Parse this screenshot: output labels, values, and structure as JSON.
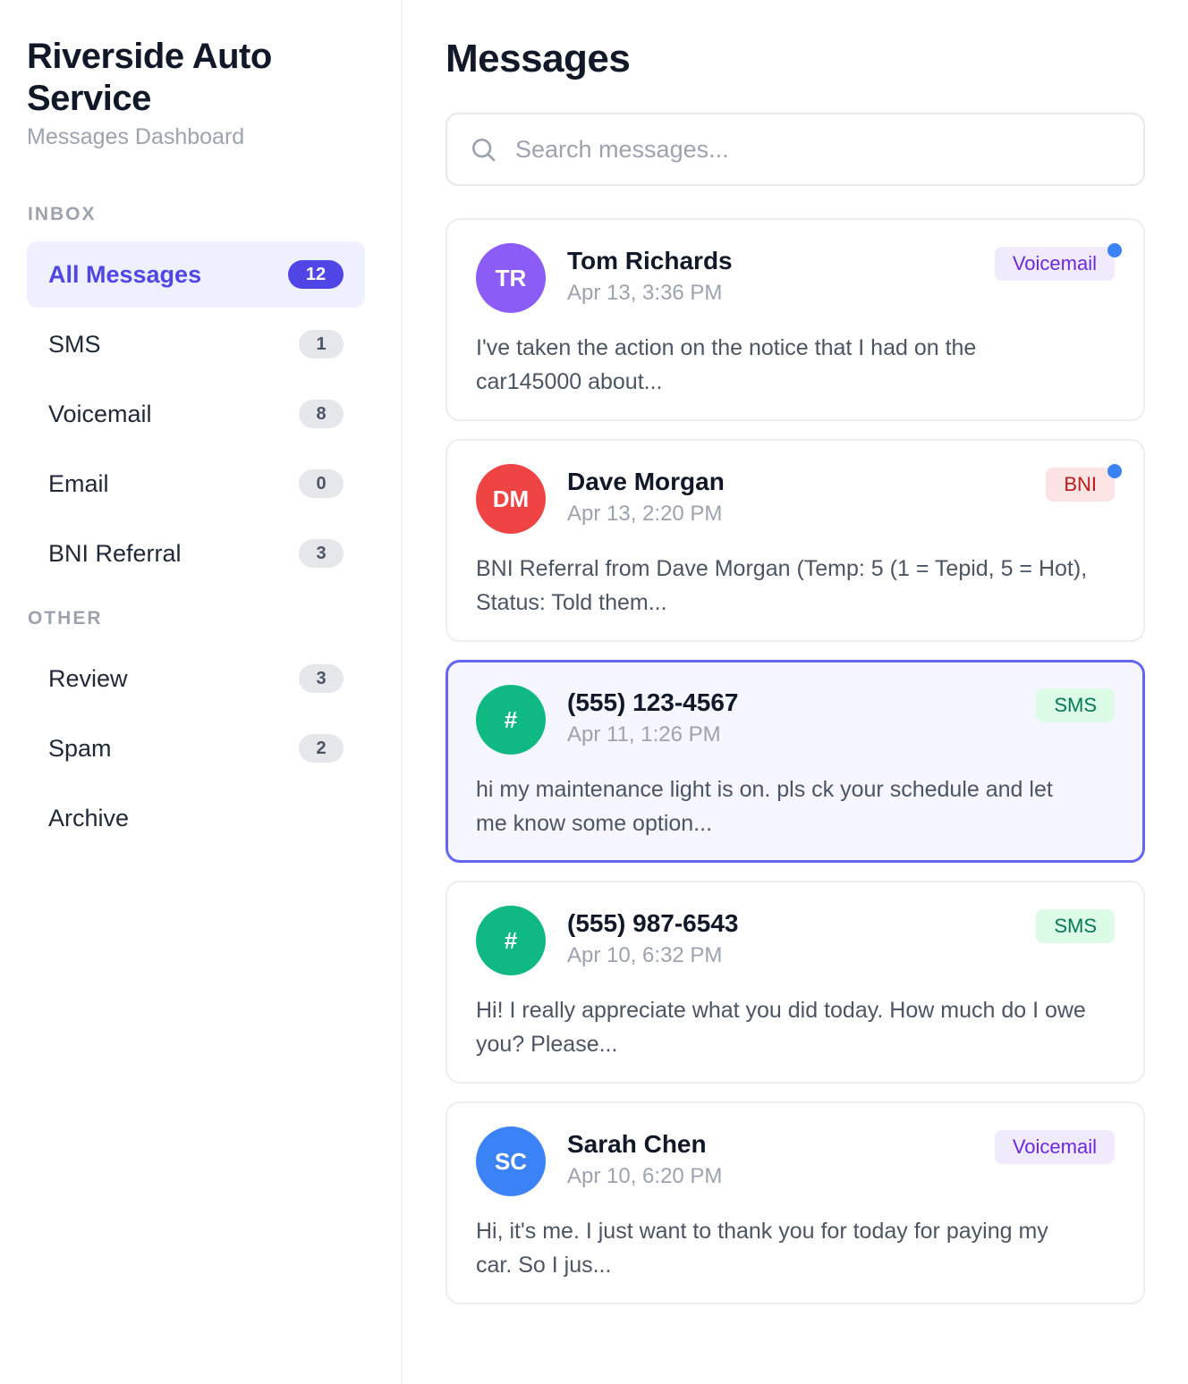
{
  "brand": {
    "title": "Riverside Auto Service",
    "subtitle": "Messages Dashboard"
  },
  "sidebar": {
    "inbox_label": "INBOX",
    "other_label": "OTHER",
    "inbox_items": [
      {
        "label": "All Messages",
        "count": "12",
        "active": true
      },
      {
        "label": "SMS",
        "count": "1"
      },
      {
        "label": "Voicemail",
        "count": "8"
      },
      {
        "label": "Email",
        "count": "0"
      },
      {
        "label": "BNI Referral",
        "count": "3"
      }
    ],
    "other_items": [
      {
        "label": "Review",
        "count": "3"
      },
      {
        "label": "Spam",
        "count": "2"
      },
      {
        "label": "Archive",
        "count": ""
      }
    ]
  },
  "main": {
    "title": "Messages",
    "search_placeholder": "Search messages..."
  },
  "messages": [
    {
      "initials": "TR",
      "avatar_color": "#8b5cf6",
      "sender": "Tom Richards",
      "time": "Apr 13, 3:36 PM",
      "type": "Voicemail",
      "unread": true,
      "preview": "I've taken the action on the notice that I had on the car145000 about..."
    },
    {
      "initials": "DM",
      "avatar_color": "#ef4444",
      "sender": "Dave Morgan",
      "time": "Apr 13, 2:20 PM",
      "type": "BNI",
      "unread": true,
      "preview": "BNI Referral from Dave Morgan (Temp: 5 (1 = Tepid, 5 = Hot), Status: Told them..."
    },
    {
      "initials": "#",
      "avatar_color": "#10b981",
      "sender": "(555) 123-4567",
      "time": "Apr 11, 1:26 PM",
      "type": "SMS",
      "unread": false,
      "selected": true,
      "preview": "hi my maintenance light is on. pls ck your schedule and let me know some option..."
    },
    {
      "initials": "#",
      "avatar_color": "#10b981",
      "sender": "(555) 987-6543",
      "time": "Apr 10, 6:32 PM",
      "type": "SMS",
      "unread": false,
      "preview": "Hi! I really appreciate what you did today. How much do I owe you? Please..."
    },
    {
      "initials": "SC",
      "avatar_color": "#3b82f6",
      "sender": "Sarah Chen",
      "time": "Apr 10, 6:20 PM",
      "type": "Voicemail",
      "unread": false,
      "preview": "Hi, it's me. I just want to thank you for today for paying my car. So I jus..."
    }
  ],
  "colors": {
    "accent": "#4f46e5",
    "selected_border": "#6366f1",
    "unread_dot": "#3b82f6"
  }
}
